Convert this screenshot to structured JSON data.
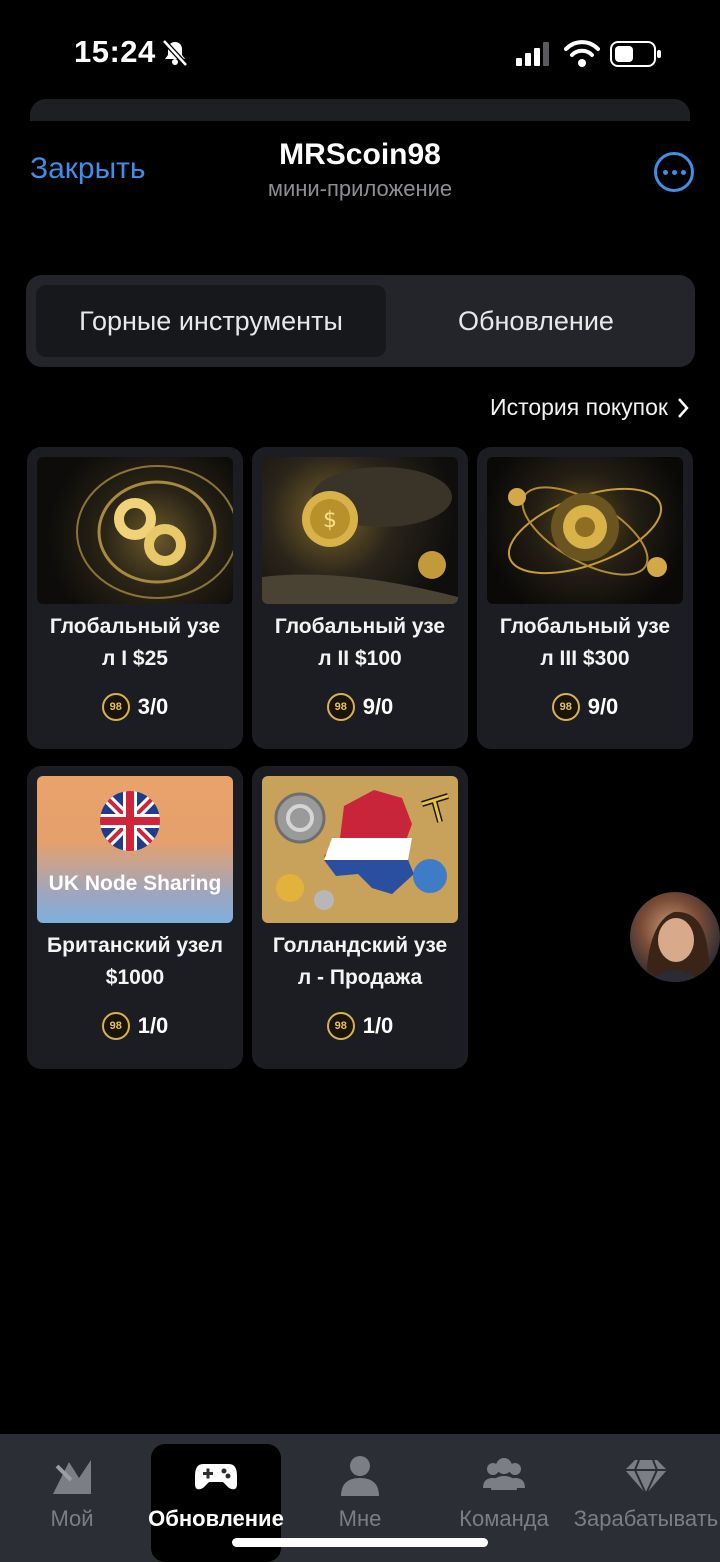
{
  "status_bar": {
    "time": "15:24"
  },
  "header": {
    "close_label": "Закрыть",
    "title": "MRScoin98",
    "subtitle": "мини-приложение"
  },
  "tabs": [
    {
      "label": "Горные инструменты",
      "active": true
    },
    {
      "label": "Обновление",
      "active": false
    }
  ],
  "history_link": "История покупок",
  "coin_symbol": "98",
  "products": [
    {
      "name": "Глобальный узе\nл I $25",
      "count": "3/0"
    },
    {
      "name": "Глобальный узе\nл II $100",
      "count": "9/0"
    },
    {
      "name": "Глобальный узе\nл III $300",
      "count": "9/0"
    },
    {
      "name": "Британский узел\n$1000",
      "count": "1/0",
      "image_text": "UK Node Sharing"
    },
    {
      "name": "Голландский узе\nл - Продажа",
      "count": "1/0"
    }
  ],
  "nav": [
    {
      "label": "Мой",
      "icon": "mine-icon",
      "active": false
    },
    {
      "label": "Обновление",
      "icon": "gamepad-icon",
      "active": true
    },
    {
      "label": "Мне",
      "icon": "person-icon",
      "active": false
    },
    {
      "label": "Команда",
      "icon": "team-icon",
      "active": false
    },
    {
      "label": "Зарабатывать",
      "icon": "diamond-icon",
      "active": false
    }
  ],
  "colors": {
    "accent": "#3f8fe8",
    "background": "#000000",
    "card": "#1b1d22",
    "nav_bg": "#2b2e34",
    "coin": "#d9b24a"
  }
}
